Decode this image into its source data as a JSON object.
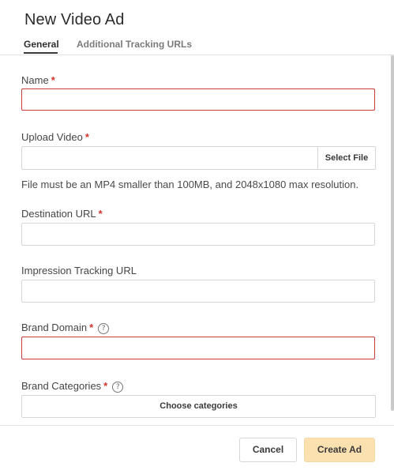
{
  "header": {
    "title": "New Video Ad"
  },
  "tabs": [
    {
      "label": "General",
      "active": true
    },
    {
      "label": "Additional Tracking URLs",
      "active": false
    }
  ],
  "form": {
    "required_marker": "*",
    "help_glyph": "?",
    "name": {
      "label": "Name",
      "value": "",
      "placeholder": ""
    },
    "upload_video": {
      "label": "Upload Video",
      "value": "",
      "button": "Select File",
      "hint": "File must be an MP4 smaller than 100MB, and 2048x1080 max resolution."
    },
    "destination_url": {
      "label": "Destination URL",
      "value": "",
      "placeholder": ""
    },
    "impression_tracking_url": {
      "label": "Impression Tracking URL",
      "value": "",
      "placeholder": ""
    },
    "brand_domain": {
      "label": "Brand Domain",
      "value": "",
      "placeholder": ""
    },
    "brand_categories": {
      "label": "Brand Categories",
      "button": "Choose categories"
    }
  },
  "footer": {
    "cancel_label": "Cancel",
    "create_label": "Create Ad"
  },
  "colors": {
    "accent": "#fbe1b0",
    "required": "#d0342c",
    "error_border": "#cc3a3a"
  }
}
